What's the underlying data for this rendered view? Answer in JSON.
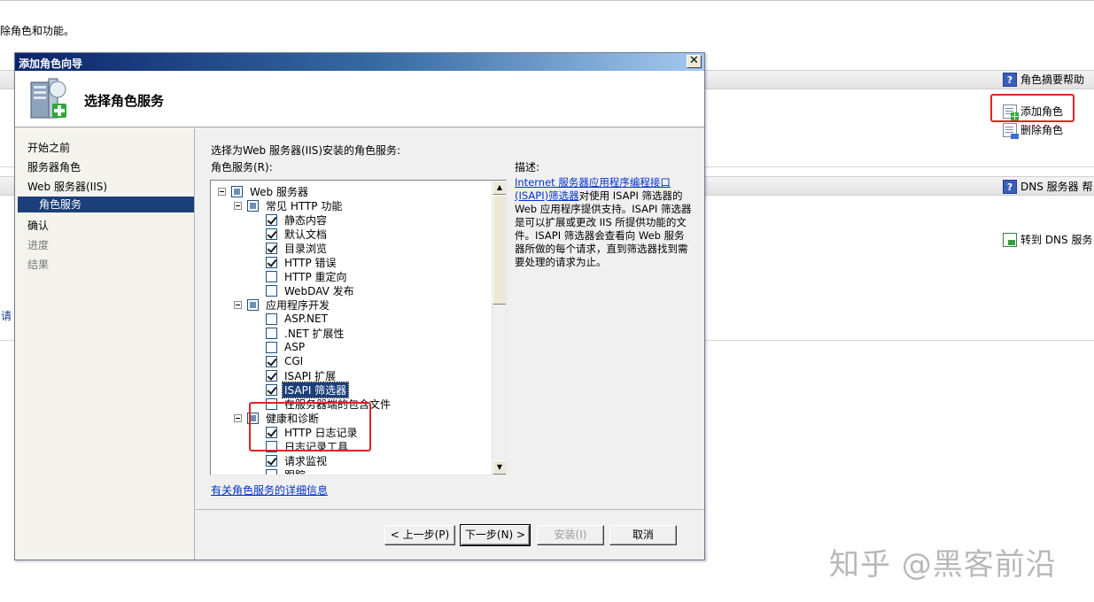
{
  "background": {
    "intro_text": "除角色和功能。",
    "left_text": "请",
    "role_summary_help": "角色摘要帮助",
    "add_role": "添加角色",
    "remove_role": "删除角色",
    "dns_help": "DNS 服务器 帮",
    "goto_dns": "转到 DNS 服务"
  },
  "wizard": {
    "title": "添加角色向导",
    "close_glyph": "✕",
    "header_title": "选择角色服务",
    "nav": [
      {
        "label": "开始之前",
        "state": "normal"
      },
      {
        "label": "服务器角色",
        "state": "normal"
      },
      {
        "label": "Web 服务器(IIS)",
        "state": "normal"
      },
      {
        "label": "角色服务",
        "state": "active"
      },
      {
        "label": "确认",
        "state": "normal"
      },
      {
        "label": "进度",
        "state": "dim"
      },
      {
        "label": "结果",
        "state": "dim"
      }
    ],
    "prompt": "选择为Web 服务器(IIS)安装的角色服务:",
    "services_label": "角色服务(R):",
    "description_label": "描述:",
    "description_link": "Internet 服务器应用程序编程接口(ISAPI)筛选器",
    "description_text": "对使用 ISAPI 筛选器的 Web 应用程序提供支持。ISAPI 筛选器是可以扩展或更改 IIS 所提供功能的文件。ISAPI 筛选器会查看向 Web 服务器所做的每个请求，直到筛选器找到需要处理的请求为止。",
    "tree": [
      {
        "label": "Web 服务器",
        "level": 0,
        "expander": true,
        "state": "indet"
      },
      {
        "label": "常见 HTTP 功能",
        "level": 1,
        "expander": true,
        "state": "indet"
      },
      {
        "label": "静态内容",
        "level": 2,
        "state": "checked"
      },
      {
        "label": "默认文档",
        "level": 2,
        "state": "checked"
      },
      {
        "label": "目录浏览",
        "level": 2,
        "state": "checked"
      },
      {
        "label": "HTTP 错误",
        "level": 2,
        "state": "checked"
      },
      {
        "label": "HTTP 重定向",
        "level": 2,
        "state": "unchecked"
      },
      {
        "label": "WebDAV 发布",
        "level": 2,
        "state": "unchecked"
      },
      {
        "label": "应用程序开发",
        "level": 1,
        "expander": true,
        "state": "indet"
      },
      {
        "label": "ASP.NET",
        "level": 2,
        "state": "unchecked"
      },
      {
        "label": ".NET 扩展性",
        "level": 2,
        "state": "unchecked"
      },
      {
        "label": "ASP",
        "level": 2,
        "state": "unchecked"
      },
      {
        "label": "CGI",
        "level": 2,
        "state": "checked"
      },
      {
        "label": "ISAPI 扩展",
        "level": 2,
        "state": "checked"
      },
      {
        "label": "ISAPI 筛选器",
        "level": 2,
        "state": "checked",
        "selected": true
      },
      {
        "label": "在服务器端的包含文件",
        "level": 2,
        "state": "unchecked"
      },
      {
        "label": "健康和诊断",
        "level": 1,
        "expander": true,
        "state": "indet"
      },
      {
        "label": "HTTP 日志记录",
        "level": 2,
        "state": "checked"
      },
      {
        "label": "日志记录工具",
        "level": 2,
        "state": "unchecked"
      },
      {
        "label": "请求监视",
        "level": 2,
        "state": "checked"
      },
      {
        "label": "跟踪",
        "level": 2,
        "state": "unchecked"
      }
    ],
    "more_info_link": "有关角色服务的详细信息",
    "buttons": {
      "back": "< 上一步(P)",
      "next": "下一步(N) >",
      "install": "安装(I)",
      "cancel": "取消"
    }
  },
  "watermark": "知乎 @黑客前沿"
}
